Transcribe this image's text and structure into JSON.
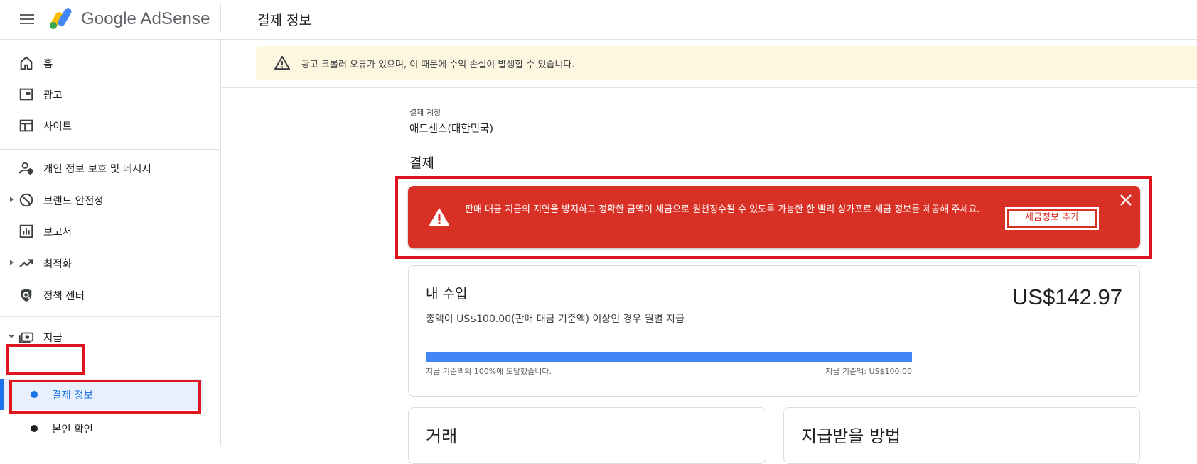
{
  "header": {
    "brand": "Google AdSense",
    "page_title": "결제 정보"
  },
  "sidebar": {
    "items": [
      {
        "label": "홈",
        "icon": "home-icon"
      },
      {
        "label": "광고",
        "icon": "ads-icon"
      },
      {
        "label": "사이트",
        "icon": "sites-icon"
      },
      {
        "label": "개인 정보 보호 및 메시지",
        "icon": "privacy-icon"
      },
      {
        "label": "브랜드 안전성",
        "icon": "block-icon"
      },
      {
        "label": "보고서",
        "icon": "reports-icon"
      },
      {
        "label": "최적화",
        "icon": "trending-icon"
      },
      {
        "label": "정책 센터",
        "icon": "policy-icon"
      },
      {
        "label": "지급",
        "icon": "payments-icon"
      }
    ],
    "sub_items": [
      {
        "label": "결제 정보",
        "active": true
      },
      {
        "label": "본인 확인",
        "active": false
      }
    ]
  },
  "alert": {
    "text": "광고 크롤러 오류가 있으며, 이 때문에 수익 손실이 발생할 수 있습니다."
  },
  "account": {
    "label": "결제 계정",
    "value": "애드센스(대한민국)"
  },
  "payments_heading": "결제",
  "error_banner": {
    "text": "판매 대금 지급의 지연을 방지하고 정확한 금액이 세금으로 원천징수될 수 있도록 가능한 한 빨리 싱가포르 세금 정보를 제공해 주세요.",
    "button": "세금정보 추가",
    "color": "#d93025"
  },
  "earnings": {
    "title": "내 수입",
    "amount": "US$142.97",
    "description": "총액이 US$100.00(판매 대금 기준액) 이상인 경우 월별 지급",
    "progress_percent": 100,
    "progress_left": "지급 기준액의 100%에 도달했습니다.",
    "progress_right": "지급 기준액: US$100.00"
  },
  "cards": {
    "transactions": "거래",
    "payment_method": "지급받을 방법"
  },
  "colors": {
    "accent": "#1a73e8",
    "progress": "#4285f4",
    "warning_bg": "#fef7e0",
    "highlight": "#e0141e"
  }
}
